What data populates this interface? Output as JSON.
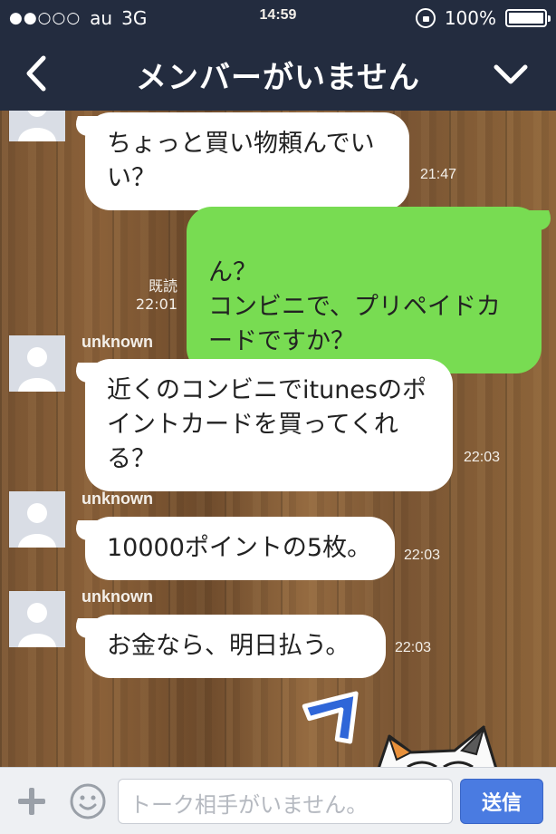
{
  "status": {
    "signal": "●●○○○",
    "carrier": "au",
    "network": "3G",
    "time": "14:59",
    "battery": "100%"
  },
  "header": {
    "title": "メンバーがいません"
  },
  "messages": [
    {
      "side": "left",
      "sender": "",
      "text": "ちょっと買い物頼んでいい？",
      "time": "21:47"
    },
    {
      "side": "right",
      "read": "既読",
      "time": "22:01",
      "text": "ん？\nコンビニで、プリペイドカードですか？"
    },
    {
      "side": "left",
      "sender": "unknown",
      "text": "近くのコンビニでitunesのポイントカードを買ってくれる？",
      "time": "22:03"
    },
    {
      "side": "left",
      "sender": "unknown",
      "text": "10000ポイントの5枚。",
      "time": "22:03"
    },
    {
      "side": "left",
      "sender": "unknown",
      "text": "お金なら、明日払う。",
      "time": "22:03"
    }
  ],
  "sticker": {
    "text": "フ"
  },
  "input": {
    "placeholder": "トーク相手がいません。",
    "send_label": "送信"
  },
  "colors": {
    "header_bg": "#232c3f",
    "own_bubble": "#78dc52",
    "send_button": "#4a7be1"
  }
}
